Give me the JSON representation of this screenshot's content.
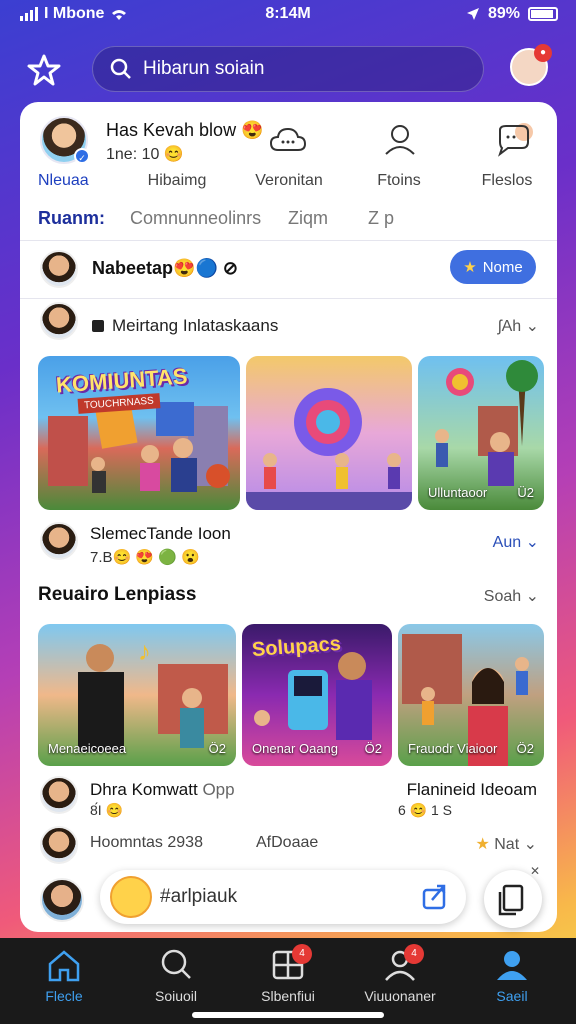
{
  "status": {
    "carrier": "I Mbone",
    "time": "8:14M",
    "battery": "89%"
  },
  "search": {
    "placeholder": "Hibarun soiain"
  },
  "profile": {
    "name": "Has Kevah blow",
    "name_emoji": "😍",
    "sub": "1ne: 10",
    "sub_emoji": "😊",
    "label": "Nleuaa"
  },
  "top_nav": [
    {
      "label": "Hibaimg",
      "icon": "hidden"
    },
    {
      "label": "Veronitan",
      "icon": "cloud-icon"
    },
    {
      "label": "Ftoins",
      "icon": "person-icon"
    },
    {
      "label": "Fleslos",
      "icon": "chat-bubble-icon"
    }
  ],
  "tabs": [
    {
      "label": "Ruanm:",
      "active": true
    },
    {
      "label": "Comnunneolinrs",
      "active": false
    },
    {
      "label": "Ziqm",
      "active": false
    },
    {
      "label": "Z p",
      "active": false
    }
  ],
  "row1": {
    "title": "Nabeetap",
    "emojis": "😍🔵",
    "button": "Nome",
    "button_icon": "★"
  },
  "row2": {
    "title": "Meirtang Inlataskaans",
    "dropdown": "ʃAh"
  },
  "gallery1": [
    {
      "title": "KOMIUNTAS",
      "subtitle": "TOUCHRNASS",
      "caption": "",
      "count": ""
    },
    {
      "title": "",
      "subtitle": "",
      "caption": "",
      "count": ""
    },
    {
      "title": "",
      "subtitle": "",
      "caption": "Ulluntaoor",
      "count": "Ü2"
    }
  ],
  "row3": {
    "title": "SlemecTande Ioon",
    "stats": "7.B😊 😍 🟢 😮",
    "link": "Aun"
  },
  "section": {
    "title": "Reuairo Lenpiass",
    "dropdown": "Soah"
  },
  "gallery2": [
    {
      "title": "",
      "caption": "Menaeicoeea",
      "count": "Ö2"
    },
    {
      "title": "Solupacs",
      "caption": "Onenar Oaang",
      "count": "Ö2"
    },
    {
      "title": "",
      "caption": "Frauodr Viaioor",
      "count": "Ö2"
    }
  ],
  "row4": {
    "name": "Dhra Komwatt",
    "name_suffix": "Opp",
    "small": "8́I 😊",
    "rname": "Flanineid Ideoam",
    "rsmall": "6 😊 1 S"
  },
  "row5": {
    "t1": "Hoomntas 2938",
    "t2": "AfDoaae",
    "t3": "Nat",
    "star": "★"
  },
  "composer": {
    "placeholder": "#arlpiauk"
  },
  "tabbar": [
    {
      "label": "Flecle",
      "active": true,
      "badge": ""
    },
    {
      "label": "Soiuoil",
      "active": false,
      "badge": ""
    },
    {
      "label": "Slbenfiui",
      "active": false,
      "badge": "4"
    },
    {
      "label": "Viuuonaner",
      "active": false,
      "badge": "4"
    },
    {
      "label": "Saeil",
      "active": true,
      "badge": ""
    }
  ],
  "colors": {
    "accent": "#2f6ee5",
    "tabbar": "#1a1a1a",
    "badge": "#e53935"
  }
}
